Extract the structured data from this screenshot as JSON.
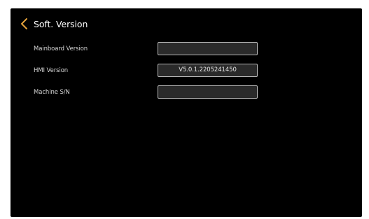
{
  "header": {
    "back_icon": "chevron-left-icon",
    "back_color": "#e3a13a",
    "title": "Soft. Version"
  },
  "rows": [
    {
      "label": "Mainboard Version",
      "value": ""
    },
    {
      "label": "HMI Version",
      "value": "V5.0.1.2205241450"
    },
    {
      "label": "Machine S/N",
      "value": ""
    }
  ]
}
